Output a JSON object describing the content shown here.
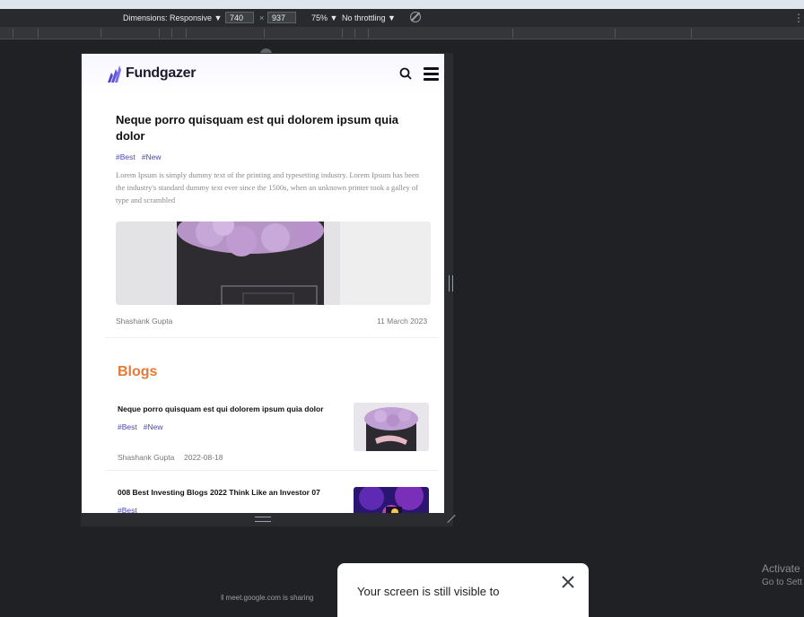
{
  "devtools": {
    "dimensions_label": "Dimensions: Responsive ▼",
    "width": "740",
    "times": "×",
    "height": "937",
    "zoom": "75% ▼",
    "throttling": "No throttling ▼"
  },
  "site": {
    "brand": "Fundgazer",
    "featured": {
      "title": "Neque porro quisquam est qui dolorem ipsum quia dolor",
      "tags": [
        "#Best",
        "#New"
      ],
      "excerpt": "Lorem Ipsum is simply dummy text of the printing and typesetting industry. Lorem Ipsum has been the industry's standard dummy text ever since the 1500s, when an unknown printer took a galley of type and scrambled",
      "author": "Shashank Gupta",
      "date": "11 March 2023"
    },
    "blogs_heading": "Blogs",
    "blogs": [
      {
        "title": "Neque porro quisquam est qui dolorem ipsum quia dolor",
        "tags": [
          "#Best",
          "#New"
        ],
        "author": "Shashank Gupta",
        "date": "2022-08-18"
      },
      {
        "title": "008 Best Investing Blogs 2022 Think Like an Investor 07",
        "tags": [
          "#Best"
        ]
      }
    ]
  },
  "toast": {
    "message": "Your screen is still visible to"
  },
  "windows_watermark": {
    "line1": "Activate",
    "line2": "Go to Sett"
  },
  "taskbar_hint": "‖  meet.google.com is sharing"
}
